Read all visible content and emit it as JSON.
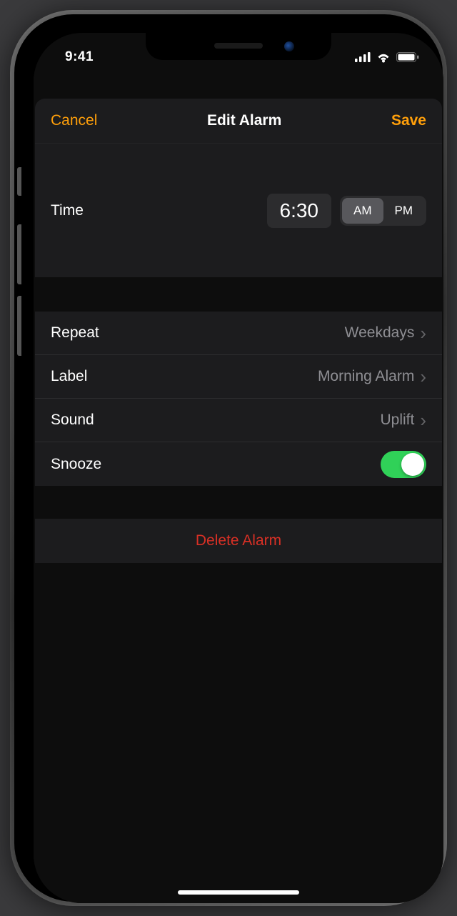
{
  "status": {
    "time": "9:41"
  },
  "nav": {
    "cancel": "Cancel",
    "title": "Edit Alarm",
    "save": "Save"
  },
  "time": {
    "label": "Time",
    "value": "6:30",
    "am": "AM",
    "pm": "PM"
  },
  "rows": {
    "repeat": {
      "label": "Repeat",
      "value": "Weekdays"
    },
    "label": {
      "label": "Label",
      "value": "Morning Alarm"
    },
    "sound": {
      "label": "Sound",
      "value": "Uplift"
    },
    "snooze": {
      "label": "Snooze"
    }
  },
  "delete": {
    "label": "Delete Alarm"
  }
}
